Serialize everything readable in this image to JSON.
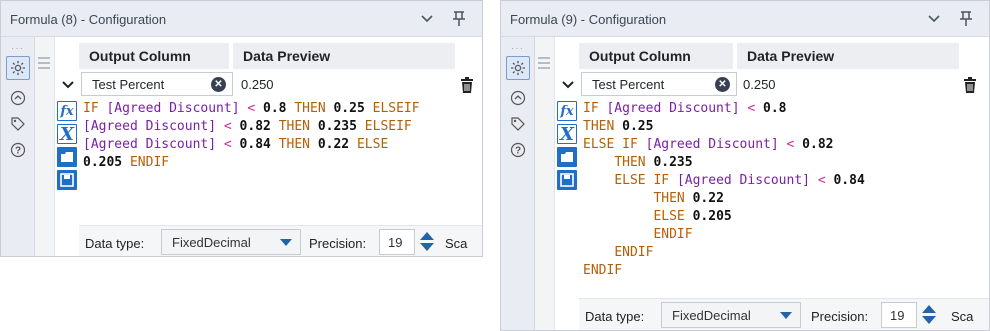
{
  "panels": [
    {
      "title": "Formula (8) - Configuration",
      "headers": {
        "output_column": "Output Column",
        "data_preview": "Data Preview"
      },
      "output_column_value": "Test Percent",
      "preview_value": "0.250",
      "expression_lines": [
        "IF [Agreed Discount] < 0.8 THEN 0.25 ELSEIF",
        "[Agreed Discount] < 0.82 THEN 0.235 ELSEIF",
        "[Agreed Discount] < 0.84 THEN 0.22 ELSE",
        "0.205 ENDIF"
      ],
      "footer": {
        "data_type_label": "Data type:",
        "data_type_value": "FixedDecimal",
        "precision_label": "Precision:",
        "precision_value": "19",
        "scale_label": "Sca"
      }
    },
    {
      "title": "Formula (9) - Configuration",
      "headers": {
        "output_column": "Output Column",
        "data_preview": "Data Preview"
      },
      "output_column_value": "Test Percent",
      "preview_value": "0.250",
      "expression_lines": [
        "IF [Agreed Discount] < 0.8",
        "THEN 0.25",
        "ELSE IF [Agreed Discount] < 0.82",
        "    THEN 0.235",
        "    ELSE IF [Agreed Discount] < 0.84",
        "         THEN 0.22",
        "         ELSE 0.205",
        "         ENDIF",
        "    ENDIF",
        "ENDIF"
      ],
      "footer": {
        "data_type_label": "Data type:",
        "data_type_value": "FixedDecimal",
        "precision_label": "Precision:",
        "precision_value": "19",
        "scale_label": "Sca"
      }
    }
  ],
  "icons": {
    "dropdown_chevron": "chevron-down-icon",
    "pin": "pin-icon",
    "settings": "gear-icon",
    "navigate": "circle-arrow-icon",
    "tag": "tag-icon",
    "help": "help-icon",
    "expand": "chevron-down-icon",
    "clear": "clear-icon",
    "delete": "trash-icon",
    "function": "fx-icon",
    "variable": "x-variable-icon",
    "open": "folder-icon",
    "save": "save-icon"
  },
  "colors": {
    "accent": "#1f6fc7",
    "keyword": "#b45f06",
    "field": "#7a1fa8",
    "operator": "#d02a96"
  }
}
